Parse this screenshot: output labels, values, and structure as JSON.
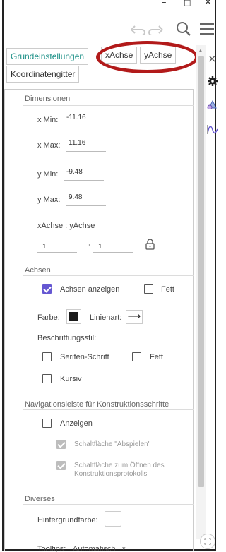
{
  "window": {
    "minimize": "–",
    "maximize": "□",
    "close": "✕"
  },
  "toolbar": {
    "undo_icon": "undo-icon",
    "redo_icon": "redo-icon",
    "search_icon": "search-icon",
    "menu_icon": "hamburger-menu-icon"
  },
  "tabs": [
    {
      "label": "Grundeinstellungen",
      "active": true
    },
    {
      "label": "xAchse",
      "active": false
    },
    {
      "label": "yAchse",
      "active": false
    },
    {
      "label": "Koordinatengitter",
      "active": false
    }
  ],
  "side_strip": {
    "close": "×"
  },
  "dimensions": {
    "title": "Dimensionen",
    "xmin_label": "x Min:",
    "xmin_value": "-11.16",
    "xmax_label": "x Max:",
    "xmax_value": "11.16",
    "ymin_label": "y Min:",
    "ymin_value": "-9.48",
    "ymax_label": "y Max:",
    "ymax_value": "9.48",
    "ratio_label": "xAchse : yAchse",
    "ratio_x": "1",
    "ratio_sep": ":",
    "ratio_y": "1"
  },
  "achsen": {
    "title": "Achsen",
    "show_axes_label": "Achsen anzeigen",
    "show_axes_checked": true,
    "bold_label": "Fett",
    "bold_checked": false,
    "color_label": "Farbe:",
    "color_value": "#1a1a1a",
    "linetype_label": "Linienart:",
    "linetype_glyph": "⟶",
    "labelstyle_label": "Beschriftungsstil:",
    "serif_label": "Serifen-Schrift",
    "serif_checked": false,
    "label_bold_label": "Fett",
    "label_bold_checked": false,
    "italic_label": "Kursiv",
    "italic_checked": false
  },
  "navigation": {
    "title": "Navigationsleiste für Konstruktionsschritte",
    "show_label": "Anzeigen",
    "show_checked": false,
    "play_label": "Schaltfläche \"Abspielen\"",
    "open_protocol_line1": "Schaltfläche zum Öffnen des",
    "open_protocol_line2": "Konstruktionsprotokolls"
  },
  "diverses": {
    "title": "Diverses",
    "bg_label": "Hintergrundfarbe:",
    "tooltips_label": "Tooltips:",
    "tooltips_value": "Automatisch",
    "tooltips_caret": "▾"
  },
  "colors": {
    "accent_teal": "#1a8f86",
    "checkbox_purple": "#6557d2",
    "highlight_oval": "#b21a1a"
  }
}
